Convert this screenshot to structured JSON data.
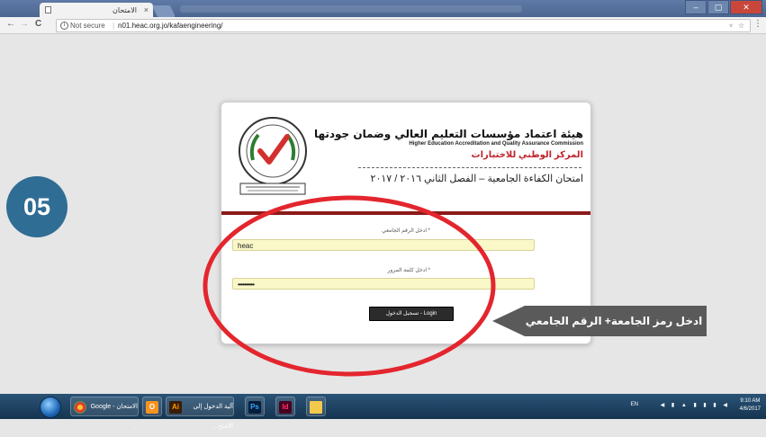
{
  "browser": {
    "tab_title": "الامتحان",
    "tab_close": "×",
    "window_buttons": [
      "–",
      "▢",
      "✕"
    ],
    "nav": {
      "back": "←",
      "forward": "→",
      "reload": "C"
    },
    "address": {
      "info_icon": "i",
      "security_label": "Not secure",
      "separator": "|",
      "url": "n01.heac.org.jo/kafaengineering/",
      "star": "☆",
      "extension": "♆"
    },
    "menu": "⋮"
  },
  "step_badge": "05",
  "card": {
    "seal_icon": "heac-seal-logo",
    "org_name_ar": "هيئة اعتماد مؤسسات التعليم العالي وضمان جودتها",
    "org_name_en": "Higher Education Accreditation and Quality Assurance Commission",
    "center_ar": "المركز الوطني للاختبارات",
    "exam_title_ar": "امتحان الكفاءة الجامعية – الفصل الثاني ٢٠١٦ / ٢٠١٧",
    "university_code_label": "* ادخل الرقم الجامعي",
    "university_code_value": "heac",
    "password_label": "* ادخل كلمة المرور",
    "password_value": "••••••••••",
    "login_button": "تسجيل الدخول - Login"
  },
  "annotation": {
    "callout_text": "ادخل رمز الجامعة+ الرقم الجامعي",
    "ellipse_color": "#e3262e",
    "callout_color": "#5a5a5a"
  },
  "taskbar": {
    "items": [
      {
        "label": "الامتحان - Google ...",
        "icon": "chrome-icon"
      },
      {
        "label": "",
        "icon": "outlook-icon"
      },
      {
        "label": "آلية الدخول إلى الامتح...",
        "icon": "illustrator-icon"
      },
      {
        "label": "",
        "icon": "photoshop-icon"
      },
      {
        "label": "",
        "icon": "indesign-icon"
      },
      {
        "label": "",
        "icon": "folder-icon"
      }
    ],
    "language": "EN",
    "time": "9:10 AM",
    "date": "4/6/2017"
  }
}
